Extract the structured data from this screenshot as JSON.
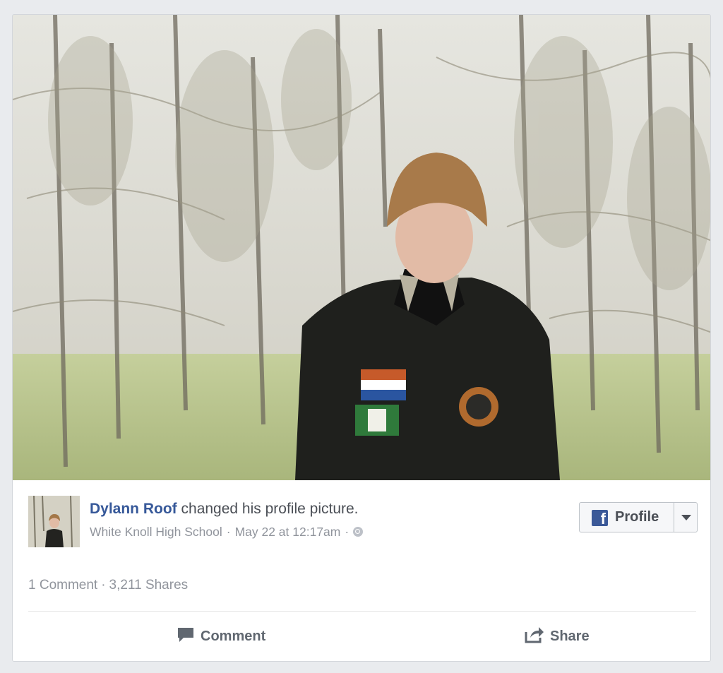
{
  "post": {
    "author": "Dylann Roof",
    "action_text": "changed his profile picture.",
    "location": "White Knoll High School",
    "separator": "·",
    "timestamp": "May 22 at 12:17am",
    "privacy_icon": "globe-icon",
    "profile_button": {
      "icon": "facebook-f-icon",
      "label": "Profile",
      "caret_icon": "chevron-down-icon"
    }
  },
  "stats": {
    "comments": "1 Comment",
    "separator": "·",
    "shares": "3,211 Shares"
  },
  "actions": {
    "comment_label": "Comment",
    "comment_icon": "speech-bubble-icon",
    "share_label": "Share",
    "share_icon": "share-arrow-icon"
  },
  "colors": {
    "link_blue": "#365899",
    "facebook_blue": "#3b5998",
    "secondary_text": "#90949c"
  }
}
